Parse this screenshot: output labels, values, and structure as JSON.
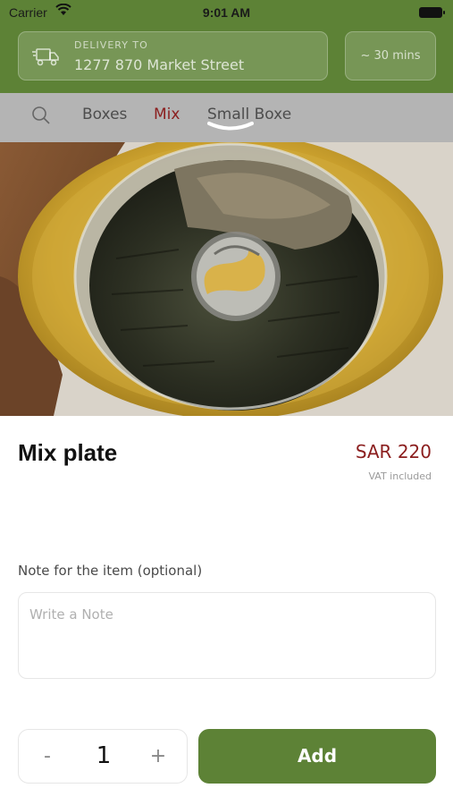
{
  "status_bar": {
    "carrier": "Carrier",
    "time": "9:01 AM"
  },
  "header": {
    "delivery_label": "DELIVERY TO",
    "address": "1277 870 Market Street",
    "eta": "~ 30 mins"
  },
  "tabs": [
    {
      "label": "Boxes",
      "active": false
    },
    {
      "label": "Mix",
      "active": true
    },
    {
      "label": "Small Boxe",
      "active": false
    }
  ],
  "product": {
    "name": "Mix plate",
    "price": "SAR 220",
    "vat_note": "VAT included"
  },
  "note": {
    "label": "Note for the item (optional)",
    "placeholder": "Write a Note",
    "value": ""
  },
  "quantity": {
    "minus": "-",
    "value": "1",
    "plus": "+"
  },
  "add_button": {
    "label": "Add"
  },
  "colors": {
    "brand": "#5d8236",
    "accent": "#8b1e1e",
    "tab_bar": "#b4b4b4"
  }
}
